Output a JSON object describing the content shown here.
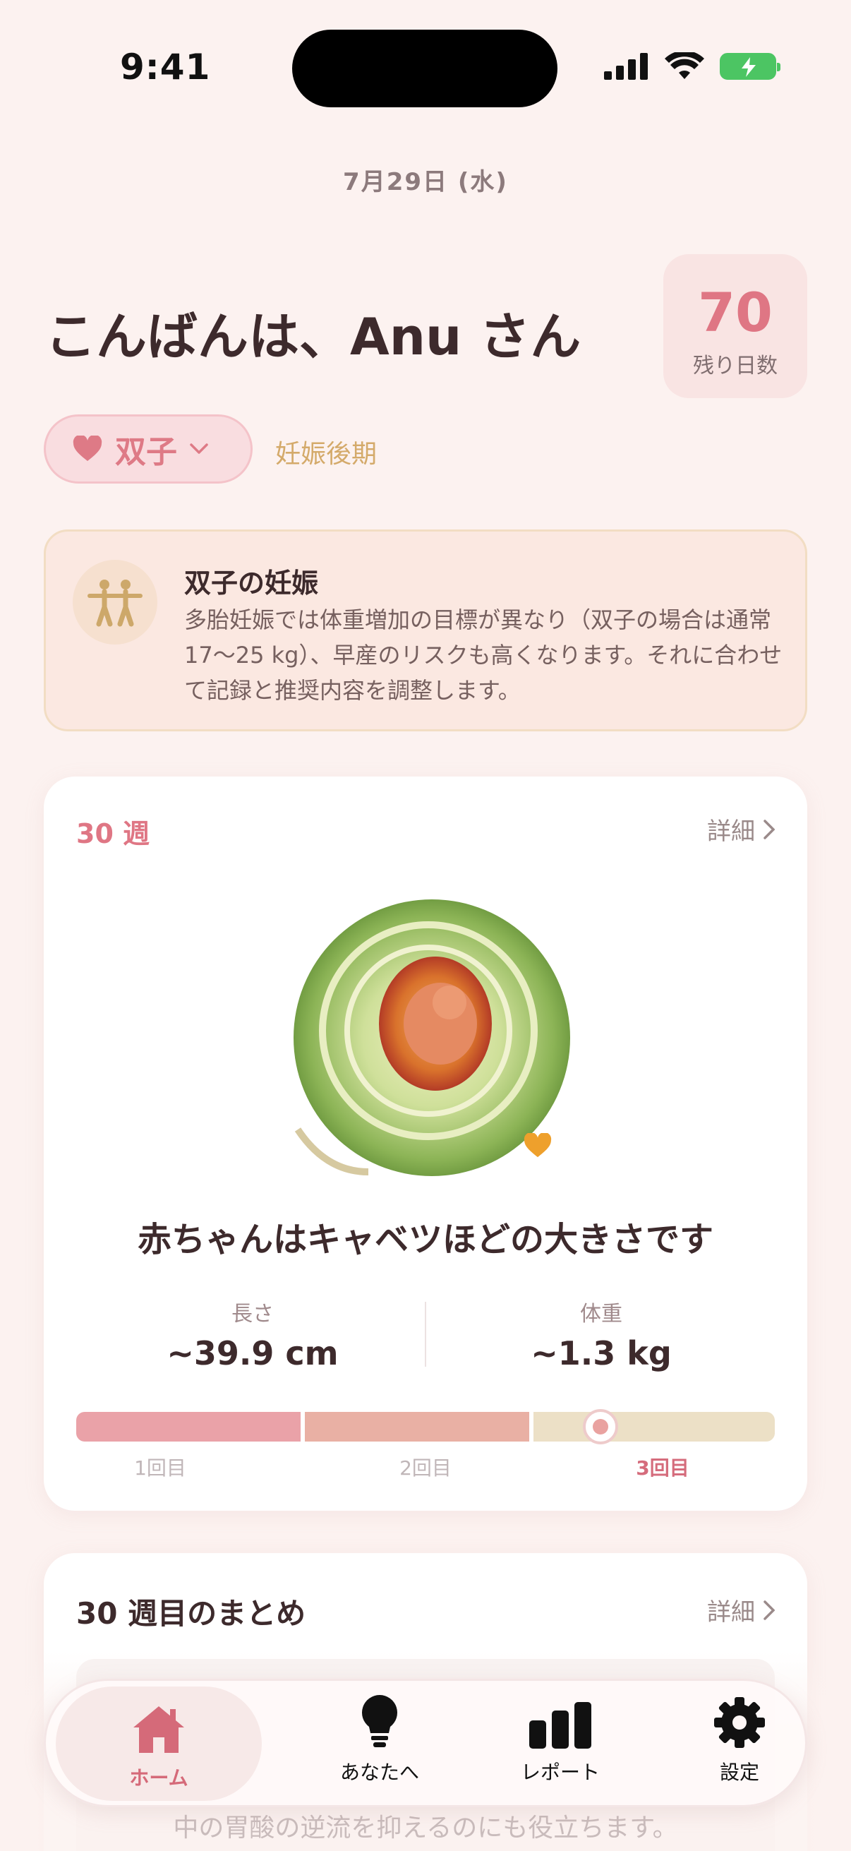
{
  "status": {
    "time": "9:41"
  },
  "date": "7月29日 (水)",
  "greeting": "こんばんは、Anu さん",
  "days_left": {
    "value": "70",
    "label": "残り日数"
  },
  "pregnancy": {
    "type_label": "双子",
    "phase": "妊娠後期"
  },
  "info_card": {
    "title": "双子の妊娠",
    "body": "多胎妊娠では体重増加の目標が異なり（双子の場合は通常17～25 kg）、早産のリスクも高くなります。それに合わせて記録と推奨内容を調整します。"
  },
  "week_card": {
    "week_label": "30 週",
    "detail_label": "詳細",
    "size_text": "赤ちゃんはキャベツほどの大きさです",
    "length": {
      "label": "長さ",
      "value": "~39.9 cm"
    },
    "weight": {
      "label": "体重",
      "value": "~1.3 kg"
    },
    "trimesters": [
      "1回目",
      "2回目",
      "3回目"
    ],
    "current_trimester": 3,
    "progress_fraction": 0.75
  },
  "summary": {
    "title": "30 週目のまとめ",
    "detail_label": "詳細",
    "partial_text": "中の胃酸の逆流を抑えるのにも役立ちます。"
  },
  "tabs": [
    {
      "label": "ホーム",
      "icon": "house-icon",
      "active": true
    },
    {
      "label": "あなたへ",
      "icon": "lightbulb-icon",
      "active": false
    },
    {
      "label": "レポート",
      "icon": "bar-chart-icon",
      "active": false
    },
    {
      "label": "設定",
      "icon": "gear-icon",
      "active": false
    }
  ],
  "colors": {
    "accent": "#df7684",
    "background": "#fcf2f0",
    "text": "#3d2a2c"
  }
}
